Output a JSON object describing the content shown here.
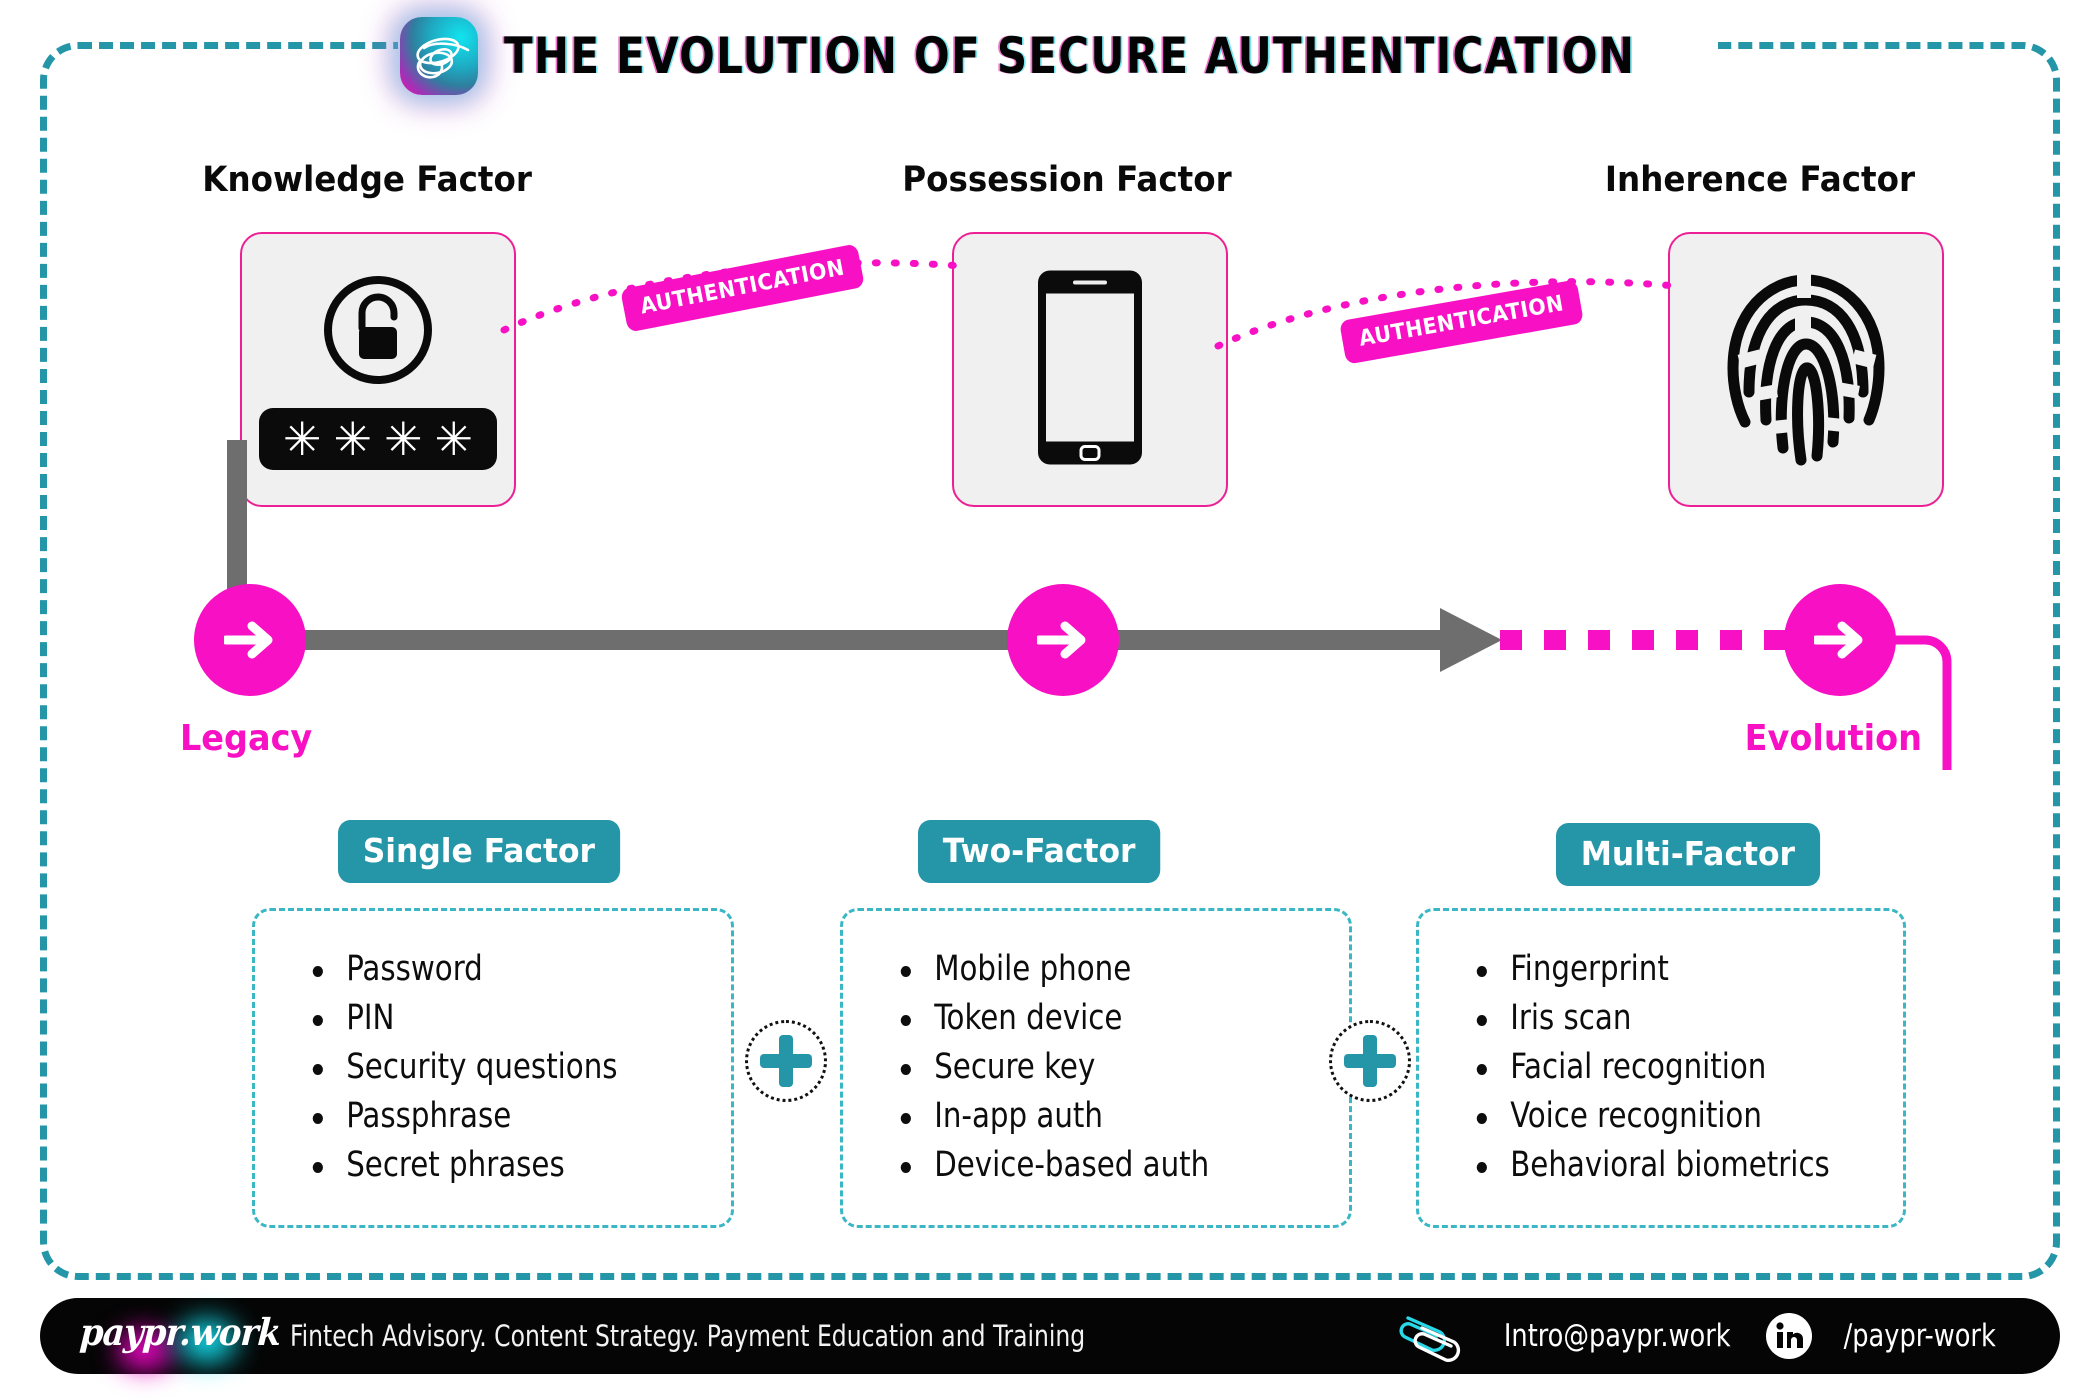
{
  "header": {
    "title": "THE EVOLUTION OF SECURE AUTHENTICATION",
    "logo_icon": "paypr-work-scribble-logo"
  },
  "colors": {
    "magenta": "#f710c4",
    "pink_border": "#ec2094",
    "teal": "#2596a8",
    "teal_dash": "#3bb6c4",
    "gray_track": "#6e6e6e",
    "card_fill": "#f0f0f0",
    "black": "#050505"
  },
  "factors": [
    {
      "heading": "Knowledge Factor",
      "icon": "open-padlock-icon",
      "pin_mask": [
        "✳",
        "✳",
        "✳",
        "✳"
      ]
    },
    {
      "heading": "Possession Factor",
      "icon": "mobile-phone-icon"
    },
    {
      "heading": "Inherence Factor",
      "icon": "fingerprint-icon"
    }
  ],
  "connectors": [
    {
      "label": "AUTHENTICATION"
    },
    {
      "label": "AUTHENTICATION"
    }
  ],
  "timeline": {
    "start_label": "Legacy",
    "end_label": "Evolution",
    "node_icon": "arrow-right-icon",
    "nodes": [
      "Legacy",
      "",
      "Evolution"
    ]
  },
  "tiers": [
    {
      "badge": "Single Factor",
      "items": [
        "Password",
        "PIN",
        "Security questions",
        "Passphrase",
        "Secret phrases"
      ]
    },
    {
      "badge": "Two-Factor",
      "items": [
        "Mobile phone",
        "Token device",
        "Secure key",
        "In-app auth",
        "Device-based auth"
      ]
    },
    {
      "badge": "Multi-Factor",
      "items": [
        "Fingerprint",
        "Iris scan",
        "Facial recognition",
        "Voice recognition",
        "Behavioral biometrics"
      ]
    }
  ],
  "combinators": [
    {
      "symbol": "plus-icon"
    },
    {
      "symbol": "plus-icon"
    }
  ],
  "footer": {
    "wordmark": "paypr.work",
    "tagline": "Fintech Advisory. Content Strategy. Payment Education and  Training",
    "email": "Intro@paypr.work",
    "email_icon": "paperclip-icon",
    "linkedin_handle": "/paypr-work",
    "linkedin_icon": "linkedin-icon"
  }
}
